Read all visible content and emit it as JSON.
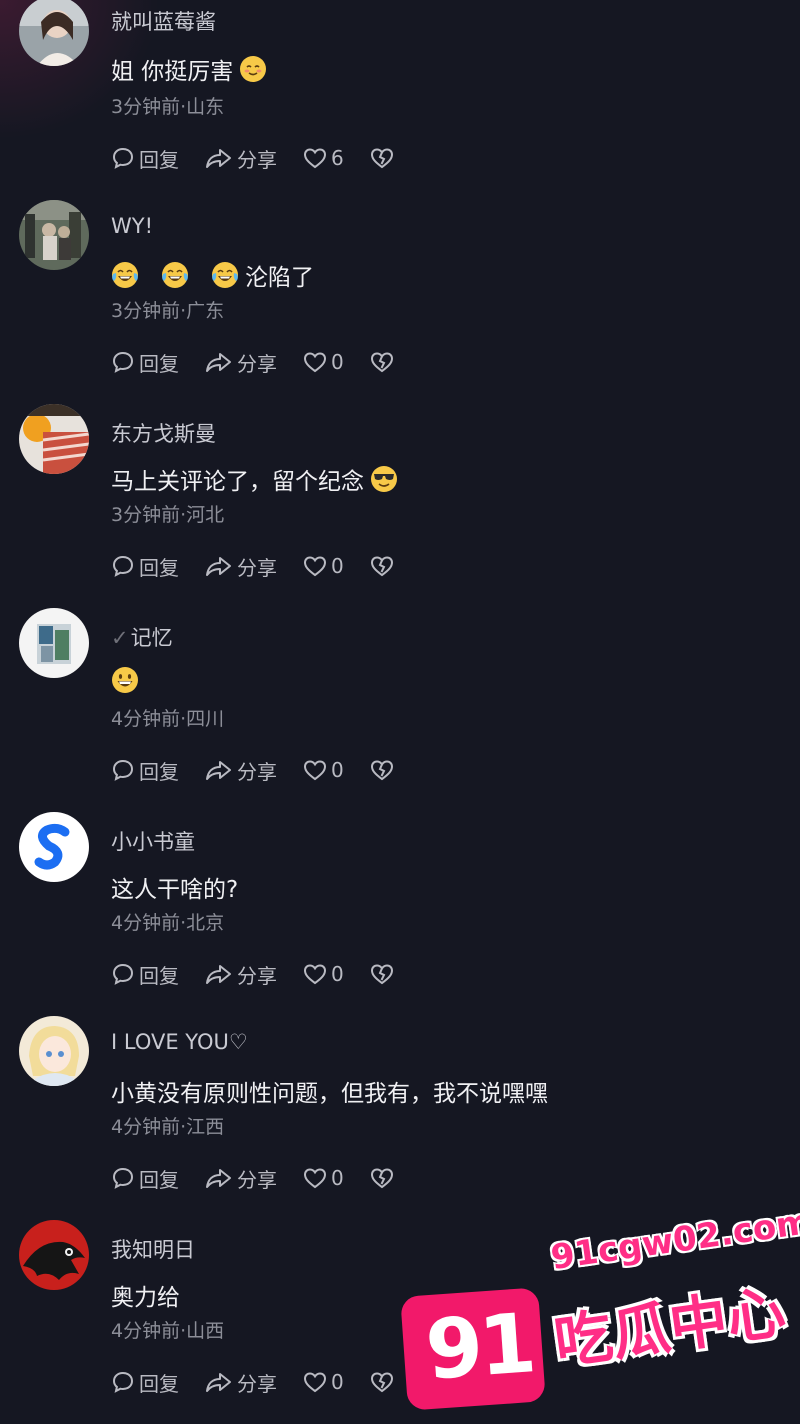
{
  "actions": {
    "reply": "回复",
    "share": "分享"
  },
  "comments": [
    {
      "username": "就叫蓝莓酱",
      "text": "姐 你挺厉害",
      "emojis": [
        "blush-emoji"
      ],
      "time": "3分钟前·山东",
      "likes": "6"
    },
    {
      "username": "WY!",
      "text": "沦陷了",
      "emojis": [
        "laugh-cry-emoji",
        "laugh-cry-emoji",
        "laugh-cry-emoji"
      ],
      "time": "3分钟前·广东",
      "likes": "0"
    },
    {
      "username": "东方戈斯曼",
      "text": "马上关评论了，留个纪念",
      "emojis": [
        "sunglasses-emoji"
      ],
      "time": "3分钟前·河北",
      "likes": "0"
    },
    {
      "username": "记忆",
      "text": "",
      "emojis": [
        "grin-emoji"
      ],
      "time": "4分钟前·四川",
      "likes": "0"
    },
    {
      "username": "小小书童",
      "text": "这人干啥的?",
      "emojis": [],
      "time": "4分钟前·北京",
      "likes": "0"
    },
    {
      "username": "I LOVE YOU♡",
      "text": "小黄没有原则性问题，但我有，我不说嘿嘿",
      "emojis": [],
      "time": "4分钟前·江西",
      "likes": "0"
    },
    {
      "username": "我知明日",
      "text": "奥力给",
      "emojis": [],
      "time": "4分钟前·山西",
      "likes": "0"
    }
  ],
  "watermark": {
    "number": "91",
    "url": "91cgw02.com",
    "name": "吃瓜中心"
  },
  "colors": {
    "background": "#151722",
    "meta": "#8c8e98",
    "watermark": "#f2196a"
  }
}
